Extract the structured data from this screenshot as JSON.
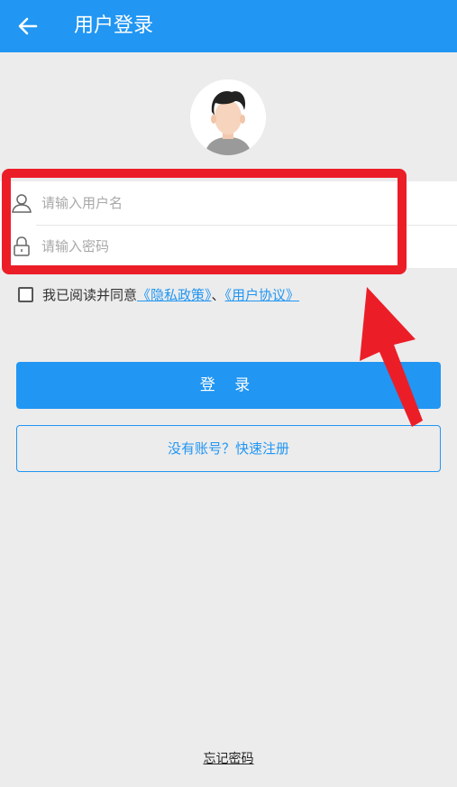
{
  "header": {
    "title": "用户登录",
    "back_icon": "arrow-left-icon"
  },
  "avatar": {
    "icon": "user-avatar-icon"
  },
  "form": {
    "username_placeholder": "请输入用户名",
    "password_placeholder": "请输入密码",
    "username_icon": "user-icon",
    "password_icon": "lock-icon"
  },
  "agreement": {
    "prefix": "我已阅读并同意",
    "privacy_link": "《隐私政策》",
    "separator": "、",
    "terms_link": "《用户协议》",
    "checked": false
  },
  "buttons": {
    "login": "登 录",
    "register": "没有账号？快速注册",
    "forgot": "忘记密码"
  },
  "colors": {
    "primary": "#2196f3",
    "highlight": "#eb1e28",
    "background": "#ececec"
  }
}
